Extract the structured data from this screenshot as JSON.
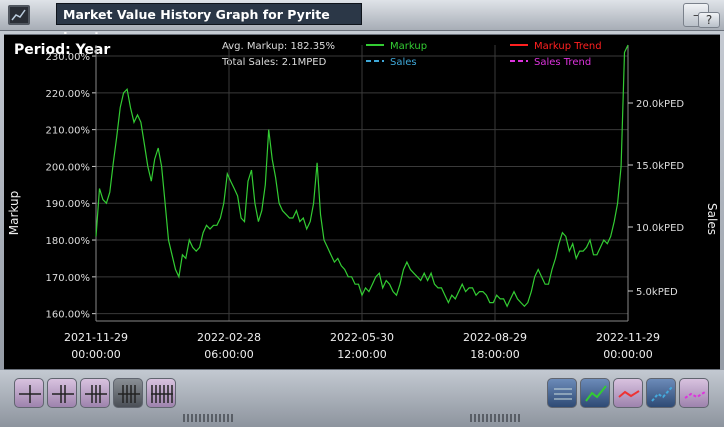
{
  "window": {
    "title": "Market Value History Graph for Pyrite Ingot"
  },
  "period_label": "Period: Year",
  "stats": {
    "avg_markup": "Avg. Markup: 182.35%",
    "total_sales": "Total Sales: 2.1MPED"
  },
  "legend": [
    {
      "label": "Markup",
      "color": "#33cc33",
      "style": "solid"
    },
    {
      "label": "Markup Trend",
      "color": "#ff2020",
      "style": "solid"
    },
    {
      "label": "Sales",
      "color": "#3fa8d8",
      "style": "dashed"
    },
    {
      "label": "Sales Trend",
      "color": "#dd33dd",
      "style": "dashed"
    }
  ],
  "title_controls": [
    "minimize-icon",
    "close-icon",
    "help-icon",
    "pin-icon"
  ],
  "chart_data": {
    "type": "line",
    "ylabel": "Markup",
    "y2label": "Sales",
    "y_ticks": [
      "230.00%",
      "220.00%",
      "210.00%",
      "200.00%",
      "190.00%",
      "180.00%",
      "170.00%",
      "160.00%"
    ],
    "y2_ticks": [
      "20.0kPED",
      "15.0kPED",
      "10.0kPED",
      "5.0kPED"
    ],
    "x_ticks": [
      {
        "date": "2021-11-29",
        "time": "00:00:00"
      },
      {
        "date": "2022-02-28",
        "time": "06:00:00"
      },
      {
        "date": "2022-05-30",
        "time": "12:00:00"
      },
      {
        "date": "2022-08-29",
        "time": "18:00:00"
      },
      {
        "date": "2022-11-29",
        "time": "00:00:00"
      }
    ],
    "ylim": [
      158,
      233
    ],
    "grid": true,
    "series": [
      {
        "name": "Markup",
        "color": "#33cc33",
        "values": [
          181,
          194,
          191,
          190,
          193,
          201,
          208,
          216,
          220,
          221,
          216,
          212,
          214,
          212,
          206,
          200,
          196,
          202,
          205,
          200,
          190,
          180,
          176,
          172,
          170,
          176,
          175,
          180,
          178,
          177,
          178,
          182,
          184,
          183,
          184,
          184,
          186,
          190,
          198,
          196,
          194,
          192,
          186,
          185,
          196,
          199,
          190,
          185,
          188,
          195,
          210,
          202,
          197,
          190,
          188,
          187,
          186,
          186,
          188,
          185,
          186,
          183,
          185,
          190,
          201,
          187,
          180,
          178,
          176,
          174,
          175,
          173,
          172,
          170,
          170,
          168,
          168,
          165,
          167,
          166,
          168,
          170,
          171,
          167,
          169,
          168,
          166,
          165,
          168,
          172,
          174,
          172,
          171,
          170,
          169,
          171,
          169,
          171,
          168,
          167,
          167,
          165,
          163,
          165,
          164,
          166,
          168,
          166,
          167,
          167,
          165,
          166,
          166,
          165,
          163,
          163,
          165,
          164,
          164,
          162,
          164,
          166,
          164,
          163,
          162,
          163,
          166,
          170,
          172,
          170,
          168,
          168,
          172,
          175,
          179,
          182,
          181,
          177,
          179,
          175,
          177,
          177,
          178,
          180,
          176,
          176,
          178,
          180,
          179,
          181,
          185,
          190,
          200,
          231,
          233
        ]
      }
    ]
  },
  "toolbar": {
    "left_buttons": [
      "grid-1-icon",
      "grid-2-icon",
      "grid-3-icon",
      "grid-4-icon",
      "grid-5-icon"
    ],
    "right_buttons": [
      "list-icon",
      "markup-line-icon",
      "markup-trend-icon",
      "sales-line-icon",
      "sales-trend-icon"
    ]
  }
}
